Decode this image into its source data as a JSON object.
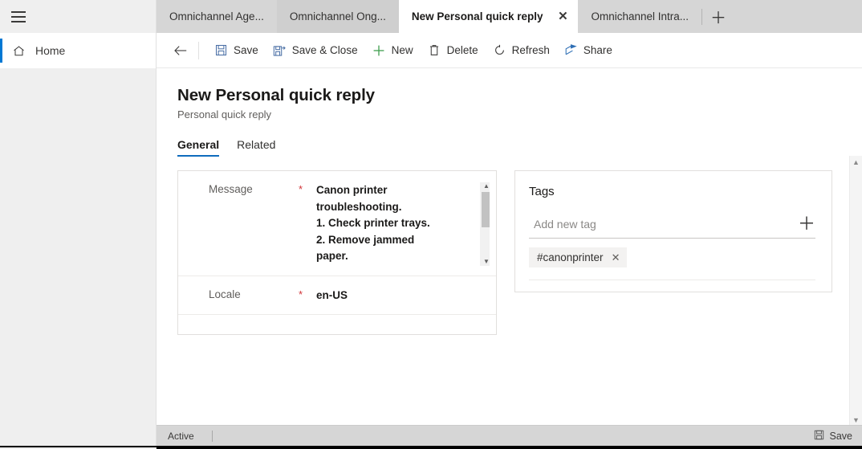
{
  "window": {
    "hamburger_icon": "hamburger-menu-icon"
  },
  "tabstrip": {
    "tabs": [
      {
        "label": "Omnichannel Age...",
        "active": false,
        "shade": false
      },
      {
        "label": "Omnichannel Ong...",
        "active": false,
        "shade": true
      },
      {
        "label": "New Personal quick reply",
        "active": true,
        "shade": false
      },
      {
        "label": "Omnichannel Intra...",
        "active": false,
        "shade": false
      }
    ],
    "close_glyph": "✕",
    "add_glyph": "＋",
    "add_icon": "new-tab-plus-icon"
  },
  "leftnav": {
    "home_label": "Home",
    "home_icon": "home-icon"
  },
  "commandbar": {
    "back_icon": "back-arrow-icon",
    "items": [
      {
        "label": "Save",
        "icon": "save-floppy-icon"
      },
      {
        "label": "Save & Close",
        "icon": "save-and-close-icon"
      },
      {
        "label": "New",
        "icon": "plus-icon"
      },
      {
        "label": "Delete",
        "icon": "trash-icon"
      },
      {
        "label": "Refresh",
        "icon": "refresh-icon"
      },
      {
        "label": "Share",
        "icon": "share-icon"
      }
    ]
  },
  "page": {
    "title": "New Personal quick reply",
    "subtitle": "Personal quick reply",
    "tabs": [
      {
        "label": "General",
        "active": true
      },
      {
        "label": "Related",
        "active": false
      }
    ]
  },
  "form": {
    "fields": [
      {
        "label": "Message",
        "required_marker": "*",
        "value": "Canon printer\ntroubleshooting.\n1. Check printer trays.\n2. Remove jammed\npaper."
      },
      {
        "label": "Locale",
        "required_marker": "*",
        "value": "en-US"
      }
    ]
  },
  "tags": {
    "title": "Tags",
    "input_placeholder": "Add new tag",
    "input_value": "",
    "add_glyph": "＋",
    "add_icon": "add-tag-plus-icon",
    "chips": [
      {
        "label": "#canonprinter",
        "remove_glyph": "✕"
      }
    ]
  },
  "scrollbars": {
    "up_glyph": "▲",
    "down_glyph": "▼"
  },
  "statusbar": {
    "state": "Active",
    "save_label": "Save",
    "save_icon": "save-floppy-icon"
  },
  "colors": {
    "accent": "#0f6cbd",
    "nav_indicator": "#0078d4",
    "required": "#d13438",
    "tabstrip_bg": "#d6d6d6",
    "panel_bg": "#efefef"
  }
}
